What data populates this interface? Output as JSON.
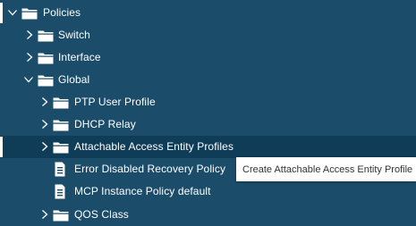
{
  "tree": {
    "policies": {
      "label": "Policies",
      "icon": "folder-icon",
      "expanded": true
    },
    "switch": {
      "label": "Switch",
      "icon": "folder-icon",
      "expanded": false
    },
    "interface": {
      "label": "Interface",
      "icon": "folder-icon",
      "expanded": false
    },
    "global": {
      "label": "Global",
      "icon": "folder-icon",
      "expanded": true
    },
    "ptp_user_profile": {
      "label": "PTP User Profile",
      "icon": "folder-icon",
      "expanded": false
    },
    "dhcp_relay": {
      "label": "DHCP Relay",
      "icon": "folder-icon",
      "expanded": false
    },
    "attachable_access_entity_profiles": {
      "label": "Attachable Access Entity Profiles",
      "icon": "folder-icon",
      "expanded": false
    },
    "error_disabled_recovery_policy": {
      "label": "Error Disabled Recovery Policy",
      "icon": "document-icon"
    },
    "mcp_instance_policy_default": {
      "label": "MCP Instance Policy default",
      "icon": "document-icon"
    },
    "qos_class": {
      "label": "QOS Class",
      "icon": "folder-icon",
      "expanded": false
    }
  },
  "tooltip": {
    "text": "Create Attachable Access Entity Profile"
  },
  "colors": {
    "background": "#1b4d6a",
    "hover_row": "#0f3c57",
    "text": "#ffffff",
    "icon": "#ffffff",
    "tooltip_bg": "#ffffff",
    "tooltip_text": "#333333"
  }
}
